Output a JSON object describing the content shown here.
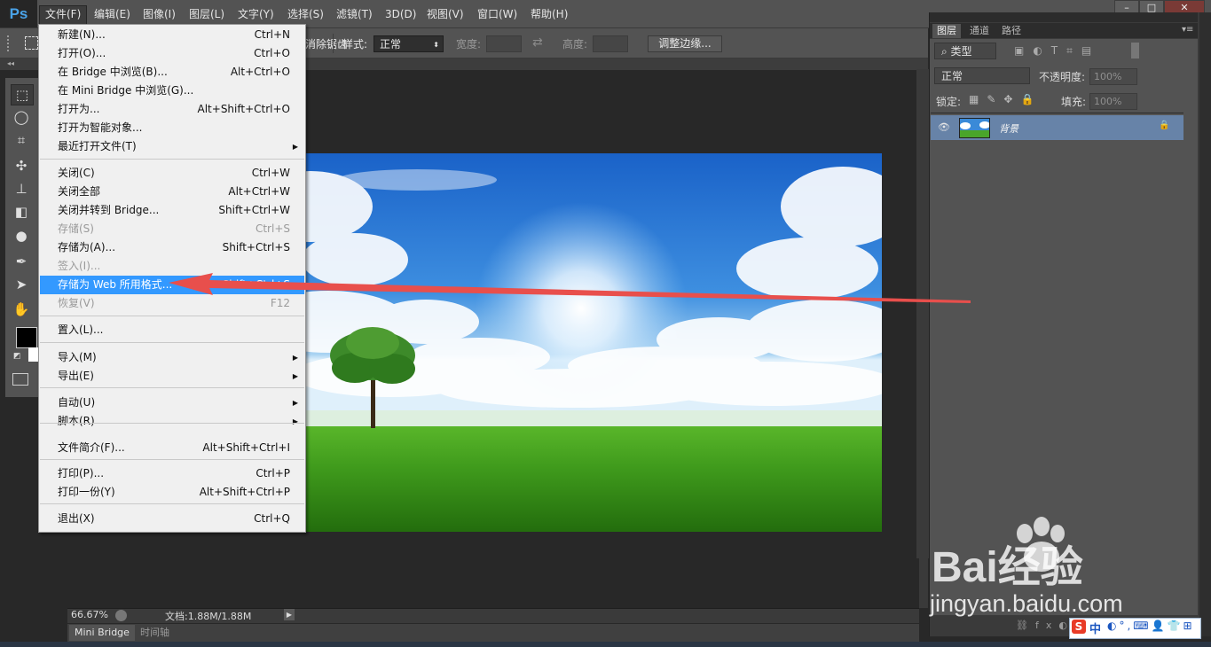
{
  "app": {
    "logo": "Ps"
  },
  "menubar": {
    "items": [
      "文件(F)",
      "编辑(E)",
      "图像(I)",
      "图层(L)",
      "文字(Y)",
      "选择(S)",
      "滤镜(T)",
      "3D(D)",
      "视图(V)",
      "窗口(W)",
      "帮助(H)"
    ],
    "active_index": 0
  },
  "optionsbar": {
    "truncated_label": "消除锯齿",
    "style_label": "样式:",
    "style_value": "正常",
    "width_label": "宽度:",
    "height_label": "高度:",
    "refine_edge_button": "调整边缘..."
  },
  "file_menu": {
    "items": [
      {
        "label": "新建(N)...",
        "shortcut": "Ctrl+N"
      },
      {
        "label": "打开(O)...",
        "shortcut": "Ctrl+O"
      },
      {
        "label": "在 Bridge 中浏览(B)...",
        "shortcut": "Alt+Ctrl+O"
      },
      {
        "label": "在 Mini Bridge 中浏览(G)...",
        "shortcut": ""
      },
      {
        "label": "打开为...",
        "shortcut": "Alt+Shift+Ctrl+O"
      },
      {
        "label": "打开为智能对象...",
        "shortcut": ""
      },
      {
        "label": "最近打开文件(T)",
        "shortcut": "",
        "submenu": true
      },
      {
        "label": "关闭(C)",
        "shortcut": "Ctrl+W"
      },
      {
        "label": "关闭全部",
        "shortcut": "Alt+Ctrl+W"
      },
      {
        "label": "关闭并转到 Bridge...",
        "shortcut": "Shift+Ctrl+W"
      },
      {
        "label": "存储(S)",
        "shortcut": "Ctrl+S",
        "disabled": true
      },
      {
        "label": "存储为(A)...",
        "shortcut": "Shift+Ctrl+S"
      },
      {
        "label": "签入(I)...",
        "shortcut": "",
        "disabled": true
      },
      {
        "label": "存储为 Web 所用格式...",
        "shortcut": "Alt+Shift+Ctrl+S",
        "highlighted": true
      },
      {
        "label": "恢复(V)",
        "shortcut": "F12",
        "disabled": true
      },
      {
        "label": "置入(L)...",
        "shortcut": ""
      },
      {
        "label": "导入(M)",
        "shortcut": "",
        "submenu": true
      },
      {
        "label": "导出(E)",
        "shortcut": "",
        "submenu": true
      },
      {
        "label": "自动(U)",
        "shortcut": "",
        "submenu": true
      },
      {
        "label": "脚本(R)",
        "shortcut": "",
        "submenu": true
      },
      {
        "label": "文件简介(F)...",
        "shortcut": "Alt+Shift+Ctrl+I"
      },
      {
        "label": "打印(P)...",
        "shortcut": "Ctrl+P"
      },
      {
        "label": "打印一份(Y)",
        "shortcut": "Alt+Shift+Ctrl+P"
      },
      {
        "label": "退出(X)",
        "shortcut": "Ctrl+Q"
      }
    ]
  },
  "status": {
    "zoom": "66.67%",
    "doc": "文档:1.88M/1.88M"
  },
  "bottom_tabs": [
    "Mini Bridge",
    "时间轴"
  ],
  "layers_panel": {
    "tabs": [
      "图层",
      "通道",
      "路径"
    ],
    "filter_kind": "类型",
    "blend_mode": "正常",
    "opacity_label": "不透明度:",
    "opacity_value": "100%",
    "lock_label": "锁定:",
    "fill_label": "填充:",
    "fill_value": "100%",
    "layers": [
      {
        "name": "背景",
        "locked": true,
        "visible": true
      }
    ]
  },
  "watermark": {
    "text": "Bai经验",
    "domain": "jingyan.baidu.com"
  },
  "ime": {
    "text": "中"
  },
  "colors": {
    "highlight": "#3399ff",
    "arrow": "#e8514f",
    "panel": "#535353"
  }
}
